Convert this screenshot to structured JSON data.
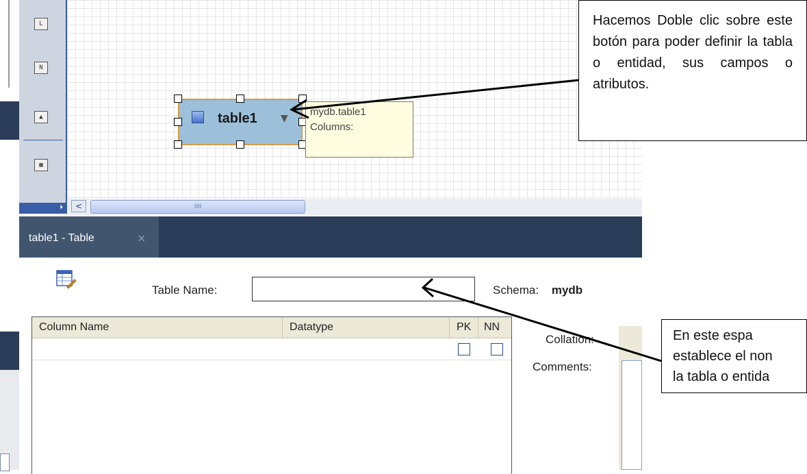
{
  "palette": {
    "tools": [
      {
        "icon": "layer-icon",
        "glyph": "L"
      },
      {
        "icon": "note-icon",
        "glyph": "N"
      },
      {
        "icon": "image-icon",
        "glyph": "▲"
      },
      {
        "icon": "table-icon",
        "glyph": "▦"
      }
    ],
    "expand_glyph": "⏵"
  },
  "canvas": {
    "entity": {
      "title": "table1",
      "arrow": "▼"
    },
    "tooltip": {
      "line1": "mydb.table1",
      "line2": "Columns:"
    },
    "scrollbar": {
      "left_arrow": "<",
      "thumb_grip": "IIII"
    }
  },
  "tabbar": {
    "tab_label": "table1 - Table",
    "close_glyph": "×"
  },
  "editor": {
    "table_name_label": "Table Name:",
    "table_name_value": "",
    "schema_label": "Schema:",
    "schema_value": "mydb",
    "columns": {
      "headers": [
        "Column Name",
        "Datatype",
        "PK",
        "NN"
      ]
    },
    "collation_label": "Collation:",
    "comments_label": "Comments:"
  },
  "callouts": {
    "top": "Hacemos Doble clic sobre este botón para poder definir la tabla o entidad, sus campos o atributos.",
    "bottom": "En este espa\nestablece el non\nla tabla o entida"
  },
  "colors": {
    "dark_bar": "#2b3c58",
    "tab_active": "#41556f",
    "entity_fill": "#9cc0da",
    "entity_border": "#d49a4a",
    "tooltip_bg": "#fffde0"
  }
}
